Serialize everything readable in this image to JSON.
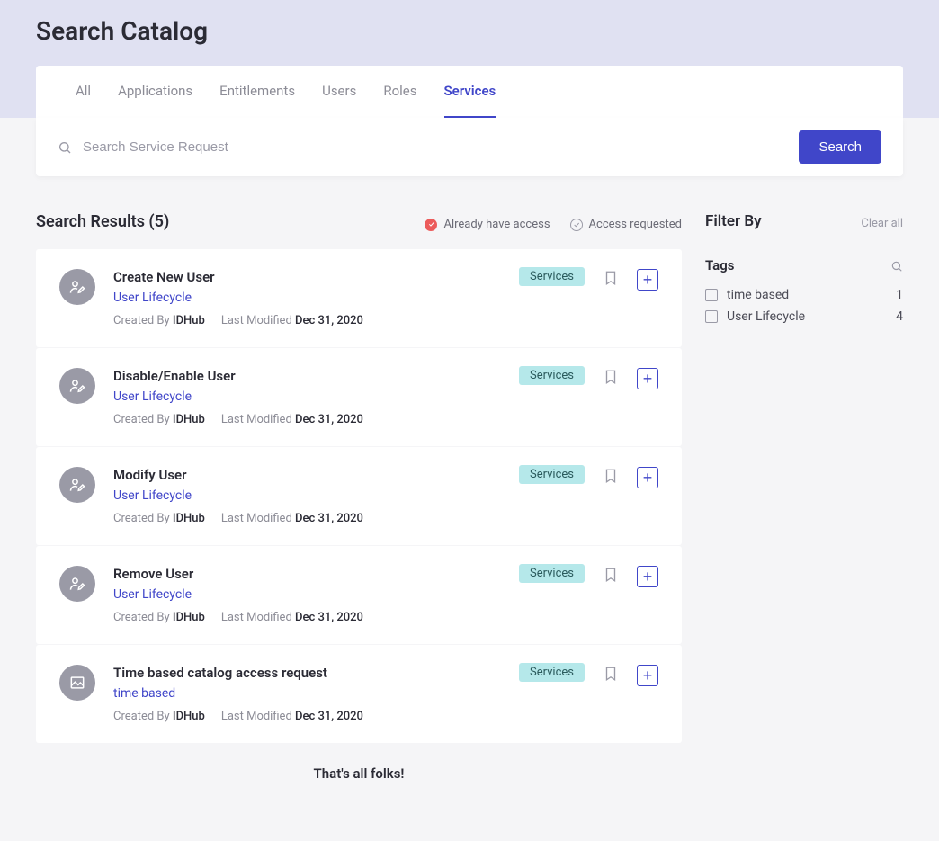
{
  "page_title": "Search Catalog",
  "tabs": [
    {
      "label": "All",
      "active": false
    },
    {
      "label": "Applications",
      "active": false
    },
    {
      "label": "Entitlements",
      "active": false
    },
    {
      "label": "Users",
      "active": false
    },
    {
      "label": "Roles",
      "active": false
    },
    {
      "label": "Services",
      "active": true
    }
  ],
  "search": {
    "placeholder": "Search Service Request",
    "button": "Search"
  },
  "results": {
    "title": "Search Results (5)",
    "legend_have": "Already have access",
    "legend_requested": "Access requested",
    "end_message": "That's all folks!",
    "created_by_label": "Created By",
    "last_modified_label": "Last Modified",
    "badge_label": "Services",
    "items": [
      {
        "title": "Create New User",
        "tag": "User Lifecycle",
        "created_by": "IDHub",
        "last_modified": "Dec 31, 2020",
        "icon": "user-edit"
      },
      {
        "title": "Disable/Enable User",
        "tag": "User Lifecycle",
        "created_by": "IDHub",
        "last_modified": "Dec 31, 2020",
        "icon": "user-edit"
      },
      {
        "title": "Modify User",
        "tag": "User Lifecycle",
        "created_by": "IDHub",
        "last_modified": "Dec 31, 2020",
        "icon": "user-edit"
      },
      {
        "title": "Remove User",
        "tag": "User Lifecycle",
        "created_by": "IDHub",
        "last_modified": "Dec 31, 2020",
        "icon": "user-edit"
      },
      {
        "title": "Time based catalog access request",
        "tag": "time based",
        "created_by": "IDHub",
        "last_modified": "Dec 31, 2020",
        "icon": "image"
      }
    ]
  },
  "filter": {
    "title": "Filter By",
    "clear": "Clear all",
    "tags_label": "Tags",
    "tags": [
      {
        "label": "time based",
        "count": "1"
      },
      {
        "label": "User Lifecycle",
        "count": "4"
      }
    ]
  }
}
